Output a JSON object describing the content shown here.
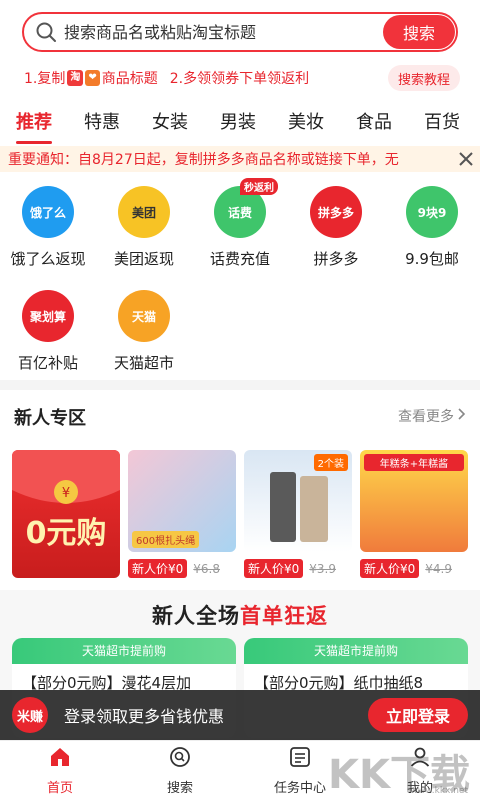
{
  "search": {
    "placeholder": "搜索商品名或粘贴淘宝标题",
    "button": "搜索"
  },
  "steps": {
    "step1_prefix": "1.复制",
    "badge1": "淘",
    "badge2": "❤",
    "step1_suffix": "商品标题",
    "step2": "2.多领领券下单领返利",
    "tutorial": "搜索教程"
  },
  "tabs": [
    "推荐",
    "特惠",
    "女装",
    "男装",
    "美妆",
    "食品",
    "百货"
  ],
  "notice": "重要通知：自8月27日起，复制拼多多商品名称或链接下单，无",
  "grid": [
    {
      "label": "饿了么返现",
      "icon_text": "饿了么",
      "color": "#1f9cf0"
    },
    {
      "label": "美团返现",
      "icon_text": "美团",
      "color": "#f7c325"
    },
    {
      "label": "话费充值",
      "icon_text": "话费",
      "color": "#3fc56b",
      "badge": "秒返利"
    },
    {
      "label": "拼多多",
      "icon_text": "拼多多",
      "color": "#e8262e"
    },
    {
      "label": "9.9包邮",
      "icon_text": "9块9",
      "color": "#3fc56b"
    },
    {
      "label": "百亿补贴",
      "icon_text": "聚划算",
      "color": "#e8262e"
    },
    {
      "label": "天猫超市",
      "icon_text": "天猫",
      "color": "#f7a325"
    }
  ],
  "newUser": {
    "title": "新人专区",
    "view_more": "查看更多",
    "zero_buy": "0元购",
    "products": [
      {
        "new_price": "新人价¥0",
        "old_price": "¥6.8",
        "img_caption": "600根扎头绳"
      },
      {
        "new_price": "新人价¥0",
        "old_price": "¥3.9",
        "img_caption": "2个装"
      },
      {
        "new_price": "新人价¥0",
        "old_price": "¥4.9",
        "img_caption": "年糕条+年糕酱"
      }
    ]
  },
  "banner": {
    "title_prefix": "新人全场",
    "title_accent": "首单狂返",
    "promo_head": "天猫超市提前购",
    "promo1": "【部分0元购】漫花4层加",
    "promo2": "【部分0元购】纸巾抽纸8"
  },
  "loginBar": {
    "logo": "米赚",
    "text": "登录领取更多省钱优惠",
    "button": "立即登录"
  },
  "nav": [
    {
      "label": "首页",
      "icon": "home-icon"
    },
    {
      "label": "搜索",
      "icon": "search-icon"
    },
    {
      "label": "任务中心",
      "icon": "task-icon"
    },
    {
      "label": "我的",
      "icon": "user-icon"
    }
  ],
  "watermark": {
    "main": "KK下载",
    "sub": "www.kkx.net"
  },
  "colors": {
    "brand": "#e8262e",
    "notice_bg": "#fff4e6"
  }
}
